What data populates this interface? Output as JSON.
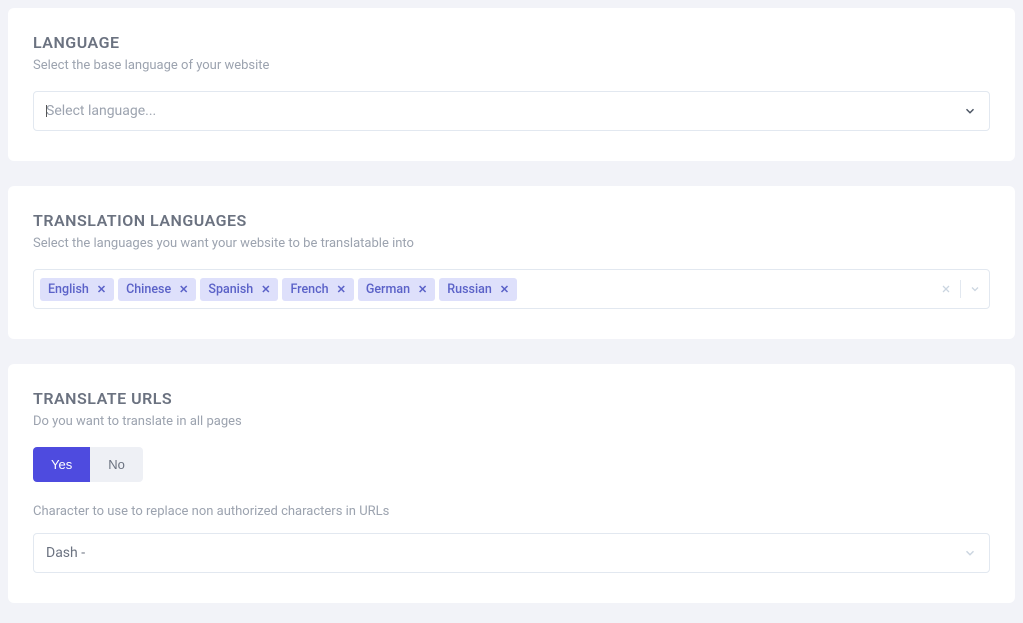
{
  "language": {
    "title": "LANGUAGE",
    "sub": "Select the base language of your website",
    "placeholder": "Select language..."
  },
  "translation": {
    "title": "TRANSLATION LANGUAGES",
    "sub": "Select the languages you want your website to be translatable into",
    "tags": [
      "English",
      "Chinese",
      "Spanish",
      "French",
      "German",
      "Russian"
    ]
  },
  "translateUrls": {
    "title": "TRANSLATE URLS",
    "sub": "Do you want to translate in all pages",
    "yes": "Yes",
    "no": "No",
    "charLabel": "Character to use to replace non authorized characters in URLs",
    "charValue": "Dash -"
  }
}
